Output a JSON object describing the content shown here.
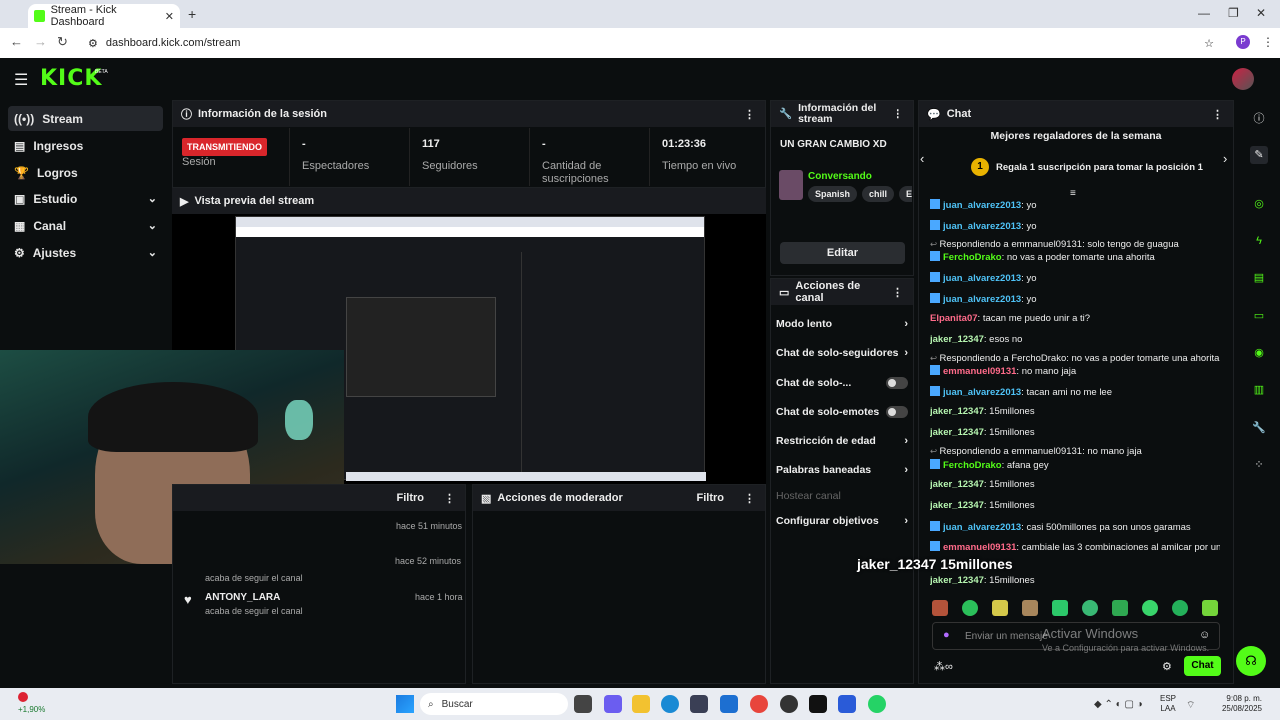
{
  "browser": {
    "tab_title": "Stream - Kick Dashboard",
    "url": "dashboard.kick.com/stream",
    "profile_initial": "P"
  },
  "kick": {
    "logo": "KICK",
    "beta": "BETA"
  },
  "sidebar": {
    "items": [
      {
        "label": "Stream",
        "icon": "stream-icon"
      },
      {
        "label": "Ingresos",
        "icon": "money-icon"
      },
      {
        "label": "Logros",
        "icon": "trophy-icon"
      },
      {
        "label": "Estudio",
        "icon": "studio-icon"
      },
      {
        "label": "Canal",
        "icon": "channel-icon"
      },
      {
        "label": "Ajustes",
        "icon": "gear-icon"
      }
    ]
  },
  "session": {
    "title": "Información de la sesión",
    "status": "TRANSMITIENDO",
    "status_label": "Sesión",
    "stats": [
      {
        "value": "-",
        "label": "Espectadores"
      },
      {
        "value": "117",
        "label": "Seguidores"
      },
      {
        "value": "-",
        "label": "Cantidad de suscripciones"
      },
      {
        "value": "01:23:36",
        "label": "Tiempo en vivo"
      }
    ]
  },
  "preview": {
    "title": "Vista previa del stream"
  },
  "activity": {
    "filter": "Filtro",
    "items": [
      {
        "name": "",
        "sub": "",
        "time": "hace 51 minutos"
      },
      {
        "name": "",
        "sub": "acaba de seguir el canal",
        "time": "hace 52 minutos"
      },
      {
        "name": "ANTONY_LARA",
        "sub": "acaba de seguir el canal",
        "time": "hace 1 hora"
      }
    ]
  },
  "mod_actions": {
    "title": "Acciones de moderador",
    "filter": "Filtro"
  },
  "channel_info": {
    "title": "Información del stream",
    "stream_title": "UN GRAN CAMBIO XD",
    "category": "Conversando",
    "tags": [
      "Spanish",
      "chill",
      "Esp"
    ],
    "edit": "Editar"
  },
  "channel_actions": {
    "title": "Acciones de canal",
    "items": [
      {
        "label": "Modo lento",
        "kind": "arrow"
      },
      {
        "label": "Chat de solo-seguidores",
        "kind": "arrow"
      },
      {
        "label": "Chat de solo-...",
        "kind": "toggle"
      },
      {
        "label": "Chat de solo-emotes",
        "kind": "toggle"
      },
      {
        "label": "Restricción de edad",
        "kind": "arrow"
      },
      {
        "label": "Palabras baneadas",
        "kind": "arrow"
      },
      {
        "label": "Hostear canal",
        "kind": "disabled"
      },
      {
        "label": "Configurar objetivos",
        "kind": "arrow"
      }
    ]
  },
  "chat": {
    "title": "Chat",
    "top_gifters": "Mejores regaladores de la semana",
    "rank": "1",
    "gift_cta": "Regala 1 suscripción para tomar la posición 1",
    "messages": [
      {
        "user": "juan_alvarez2013",
        "text": "yo",
        "color": "#4fc3f7",
        "badge": true
      },
      {
        "user": "juan_alvarez2013",
        "text": "yo",
        "color": "#4fc3f7",
        "badge": true
      },
      {
        "reply": "Respondiendo a emmanuel09131: solo tengo de guagua"
      },
      {
        "user": "FerchoDrako",
        "text": "no vas a poder tomarte una ahorita",
        "color": "#53fc18",
        "badge": true
      },
      {
        "user": "juan_alvarez2013",
        "text": "yo",
        "color": "#4fc3f7",
        "badge": true
      },
      {
        "user": "juan_alvarez2013",
        "text": "yo",
        "color": "#4fc3f7",
        "badge": true
      },
      {
        "user": "Elpanita07",
        "text": "tacan me puedo unir a ti?",
        "color": "#ff6b8a",
        "badge": false
      },
      {
        "user": "jaker_12347",
        "text": "esos no",
        "color": "#b6f5b0",
        "badge": false
      },
      {
        "reply": "Respondiendo a FerchoDrako: no vas a poder tomarte una ahorita"
      },
      {
        "user": "emmanuel09131",
        "text": "no mano jaja",
        "color": "#ff6b8a",
        "badge": true
      },
      {
        "user": "juan_alvarez2013",
        "text": "tacan ami no me lee",
        "color": "#4fc3f7",
        "badge": true
      },
      {
        "user": "jaker_12347",
        "text": "15millones",
        "color": "#b6f5b0",
        "badge": false
      },
      {
        "user": "jaker_12347",
        "text": "15millones",
        "color": "#b6f5b0",
        "badge": false
      },
      {
        "reply": "Respondiendo a emmanuel09131: no mano jaja"
      },
      {
        "user": "FerchoDrako",
        "text": "afana gey",
        "color": "#53fc18",
        "badge": true
      },
      {
        "user": "jaker_12347",
        "text": "15millones",
        "color": "#b6f5b0",
        "badge": false
      },
      {
        "user": "jaker_12347",
        "text": "15millones",
        "color": "#b6f5b0",
        "badge": false
      },
      {
        "user": "juan_alvarez2013",
        "text": "casi 500millones pa son unos garamas",
        "color": "#4fc3f7",
        "badge": true
      },
      {
        "user": "emmanuel09131",
        "text": "cambiale las 3 combinaciones al amilcar por un dragon",
        "color": "#ff6b8a",
        "badge": true
      },
      {
        "user": "jaker_12347",
        "text": "15millones",
        "color": "#b6f5b0",
        "badge": false
      }
    ],
    "input_placeholder": "Enviar un mensaje",
    "send": "Chat"
  },
  "overlay_text": "jaker_12347  15millones",
  "windows": {
    "activate": "Activar Windows",
    "activate_sub": "Ve a Configuración para activar Windows.",
    "search": "Buscar",
    "weather": "+1,90%",
    "lang": "ESP",
    "lang2": "LAA",
    "time": "9:08 p. m.",
    "date": "25/08/2025"
  }
}
